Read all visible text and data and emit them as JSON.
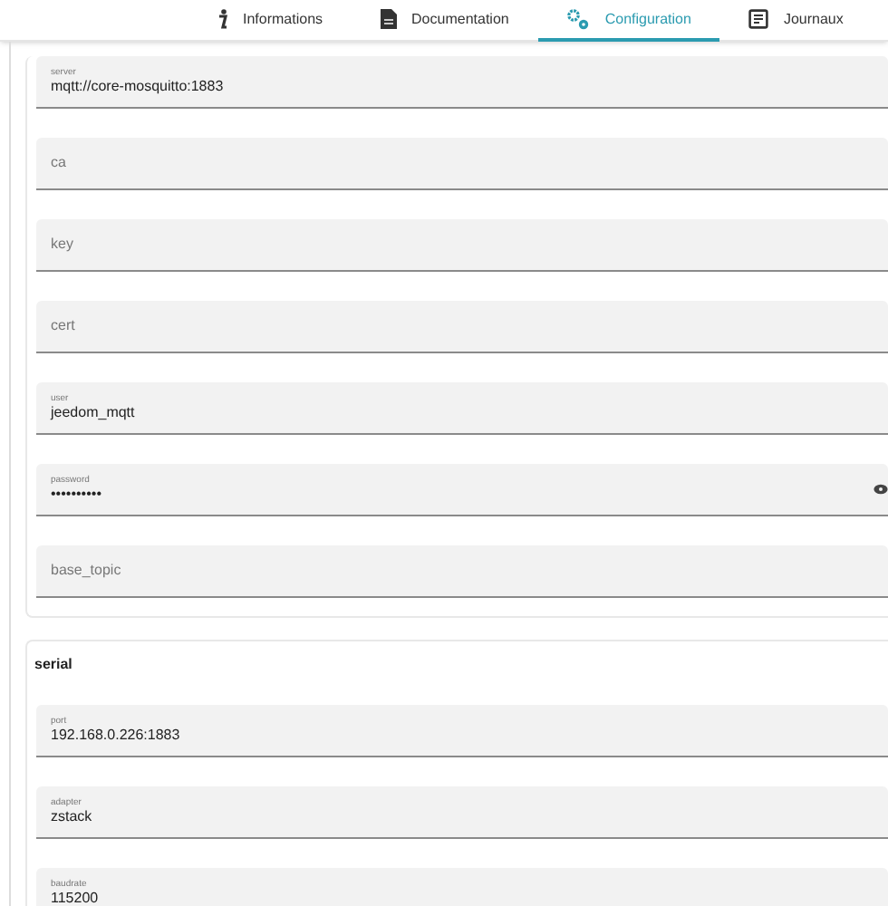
{
  "tabs": [
    {
      "label": "Informations",
      "selected": false
    },
    {
      "label": "Documentation",
      "selected": false
    },
    {
      "label": "Configuration",
      "selected": true
    },
    {
      "label": "Journaux",
      "selected": false
    }
  ],
  "sections": [
    {
      "fields": [
        {
          "label": "server",
          "value": "mqtt://core-mosquitto:1883"
        },
        {
          "label": "ca"
        },
        {
          "label": "key"
        },
        {
          "label": "cert"
        },
        {
          "label": "user",
          "value": "jeedom_mqtt"
        },
        {
          "label": "password",
          "value": "••••••••••",
          "kind": "password"
        },
        {
          "label": "base_topic"
        }
      ]
    },
    {
      "title": "serial",
      "fields": [
        {
          "label": "port",
          "value": "192.168.0.226:1883"
        },
        {
          "label": "adapter",
          "value": "zstack"
        },
        {
          "label": "baudrate",
          "value": "115200"
        }
      ]
    }
  ]
}
